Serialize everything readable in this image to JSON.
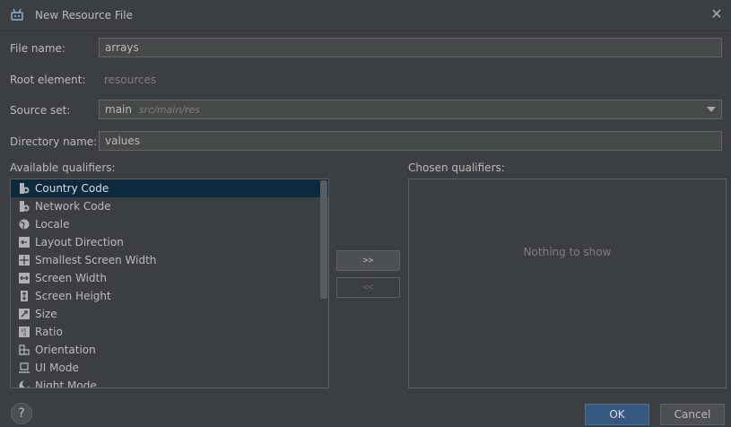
{
  "window": {
    "title": "New Resource File",
    "close_glyph": "✕"
  },
  "form": {
    "file_name_label": "File name:",
    "file_name_value": "arrays",
    "root_element_label": "Root element:",
    "root_element_value": "resources",
    "source_set_label": "Source set:",
    "source_set_value": "main",
    "source_set_path": "src/main/res",
    "directory_name_label": "Directory name:",
    "directory_name_value": "values"
  },
  "available": {
    "label": "Available qualifiers:",
    "items": [
      {
        "label": "Country Code",
        "icon": "country-code-icon",
        "selected": true
      },
      {
        "label": "Network Code",
        "icon": "network-code-icon",
        "selected": false
      },
      {
        "label": "Locale",
        "icon": "globe-icon",
        "selected": false
      },
      {
        "label": "Layout Direction",
        "icon": "layout-direction-icon",
        "selected": false
      },
      {
        "label": "Smallest Screen Width",
        "icon": "smallest-width-icon",
        "selected": false
      },
      {
        "label": "Screen Width",
        "icon": "screen-width-icon",
        "selected": false
      },
      {
        "label": "Screen Height",
        "icon": "screen-height-icon",
        "selected": false
      },
      {
        "label": "Size",
        "icon": "size-icon",
        "selected": false
      },
      {
        "label": "Ratio",
        "icon": "ratio-icon",
        "selected": false
      },
      {
        "label": "Orientation",
        "icon": "orientation-icon",
        "selected": false
      },
      {
        "label": "UI Mode",
        "icon": "ui-mode-icon",
        "selected": false
      },
      {
        "label": "Night Mode",
        "icon": "night-mode-icon",
        "selected": false
      }
    ]
  },
  "transfer": {
    "add_label": ">>",
    "remove_label": "<<"
  },
  "chosen": {
    "label": "Chosen qualifiers:",
    "empty_text": "Nothing to show"
  },
  "footer": {
    "help_label": "?",
    "ok_label": "OK",
    "cancel_label": "Cancel"
  },
  "colors": {
    "background": "#3c3f41",
    "field": "#45494a",
    "selection": "#0d293e",
    "accent": "#365880",
    "android_green": "#a4c639"
  }
}
